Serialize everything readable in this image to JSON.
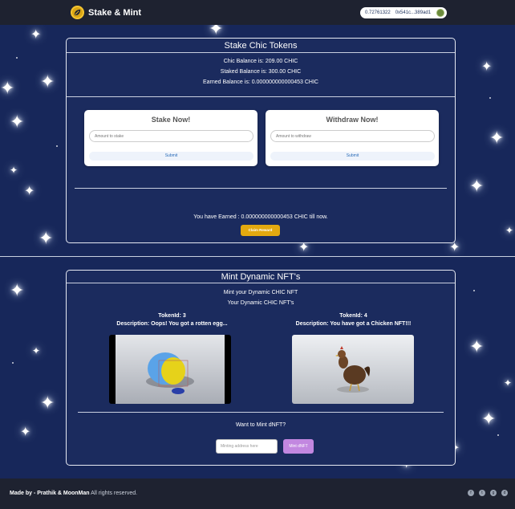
{
  "navbar": {
    "brand": "Stake & Mint",
    "wallet_balance": "0.72761322",
    "wallet_address": "0x541c...389ad1"
  },
  "stake": {
    "title": "Stake Chic Tokens",
    "chic_balance": "Chic Balance is: 209.00 CHIC",
    "staked_balance": "Staked Balance is: 300.00 CHIC",
    "earned_balance": "Earned Balance is: 0.000000000000453 CHIC",
    "stake_card": {
      "title": "Stake Now!",
      "placeholder": "Amount to stake",
      "submit": "Submit"
    },
    "withdraw_card": {
      "title": "Withdraw Now!",
      "placeholder": "Amount to withdraw",
      "submit": "Submit"
    },
    "earned_text": "You have Earned : 0.000000000000453 CHIC till now.",
    "claim_button": "Claim Reward"
  },
  "mint": {
    "title": "Mint Dynamic NFT's",
    "subtitle1": "Mint your Dynamic CHIC NFT",
    "subtitle2": "Your Dynamic CHIC NFT's",
    "nfts": [
      {
        "token": "TokenId: 3",
        "description": "Description: Oops! You got a rotten egg..."
      },
      {
        "token": "TokenId: 4",
        "description": "Description: You have got a Chicken NFT!!!"
      }
    ],
    "want_text": "Want to Mint dNFT?",
    "address_placeholder": "Minting address here",
    "mint_button": "Mint dNFT"
  },
  "footer": {
    "made_by": "Made by - Prathik & MoonMan",
    "rights": "All rights reserved."
  },
  "colors": {
    "background": "#17275a",
    "navbar": "#1e2230",
    "accent_gold": "#e3a90f",
    "accent_purple": "#c287e0"
  }
}
